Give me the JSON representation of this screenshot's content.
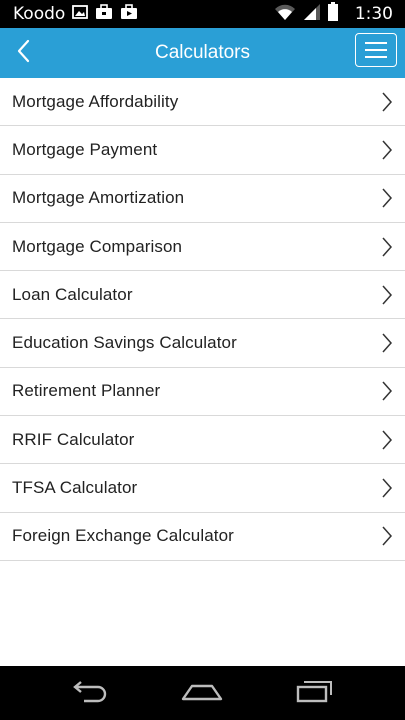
{
  "status_bar": {
    "carrier": "Koodo",
    "time": "1:30",
    "icons": [
      "image-icon",
      "briefcase-icon",
      "briefcase-icon",
      "wifi-icon",
      "signal-icon",
      "battery-icon"
    ]
  },
  "header": {
    "title": "Calculators",
    "back_icon": "chevron-left-icon",
    "menu_icon": "hamburger-menu-icon",
    "background_color": "#2a9fd6"
  },
  "calculators": [
    {
      "label": "Mortgage Affordability"
    },
    {
      "label": "Mortgage Payment"
    },
    {
      "label": "Mortgage Amortization"
    },
    {
      "label": "Mortgage Comparison"
    },
    {
      "label": "Loan Calculator"
    },
    {
      "label": "Education Savings Calculator"
    },
    {
      "label": "Retirement Planner"
    },
    {
      "label": "RRIF Calculator"
    },
    {
      "label": "TFSA Calculator"
    },
    {
      "label": "Foreign Exchange Calculator"
    }
  ],
  "nav_bar": {
    "icons": [
      "back-arrow-icon",
      "home-icon",
      "recent-apps-icon"
    ]
  }
}
